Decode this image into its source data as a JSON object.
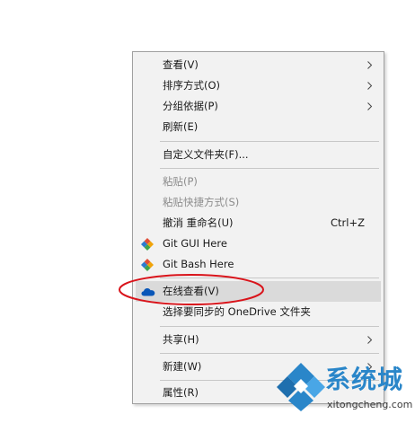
{
  "menu": {
    "items": [
      {
        "label": "查看(V)",
        "shortcut": "",
        "submenu": true,
        "disabled": false
      },
      {
        "label": "排序方式(O)",
        "shortcut": "",
        "submenu": true,
        "disabled": false
      },
      {
        "label": "分组依据(P)",
        "shortcut": "",
        "submenu": true,
        "disabled": false
      },
      {
        "label": "刷新(E)",
        "shortcut": "",
        "submenu": false,
        "disabled": false
      },
      {
        "label": "自定义文件夹(F)...",
        "shortcut": "",
        "submenu": false,
        "disabled": false
      },
      {
        "label": "粘贴(P)",
        "shortcut": "",
        "submenu": false,
        "disabled": true
      },
      {
        "label": "粘贴快捷方式(S)",
        "shortcut": "",
        "submenu": false,
        "disabled": true
      },
      {
        "label": "撤消 重命名(U)",
        "shortcut": "Ctrl+Z",
        "submenu": false,
        "disabled": false
      },
      {
        "label": "Git GUI Here",
        "shortcut": "",
        "submenu": false,
        "disabled": false,
        "icon": "git-diamond-icon"
      },
      {
        "label": "Git Bash Here",
        "shortcut": "",
        "submenu": false,
        "disabled": false,
        "icon": "git-diamond-icon"
      },
      {
        "label": "在线查看(V)",
        "shortcut": "",
        "submenu": false,
        "disabled": false,
        "icon": "onedrive-cloud-icon",
        "highlighted": true
      },
      {
        "label": "选择要同步的 OneDrive 文件夹",
        "shortcut": "",
        "submenu": false,
        "disabled": false
      },
      {
        "label": "共享(H)",
        "shortcut": "",
        "submenu": true,
        "disabled": false
      },
      {
        "label": "新建(W)",
        "shortcut": "",
        "submenu": true,
        "disabled": false
      },
      {
        "label": "属性(R)",
        "shortcut": "",
        "submenu": false,
        "disabled": false
      }
    ]
  },
  "annotation": {
    "color": "#d9141b"
  },
  "watermark": {
    "chinese_text": "系统城",
    "domain_text": "xitongcheng.com",
    "brand_color": "#2a86c9"
  },
  "colors": {
    "menu_bg": "#f2f2f2",
    "highlight_bg": "#dadada",
    "disabled_text": "#8c8c8c",
    "onedrive_blue": "#0a57b8"
  }
}
